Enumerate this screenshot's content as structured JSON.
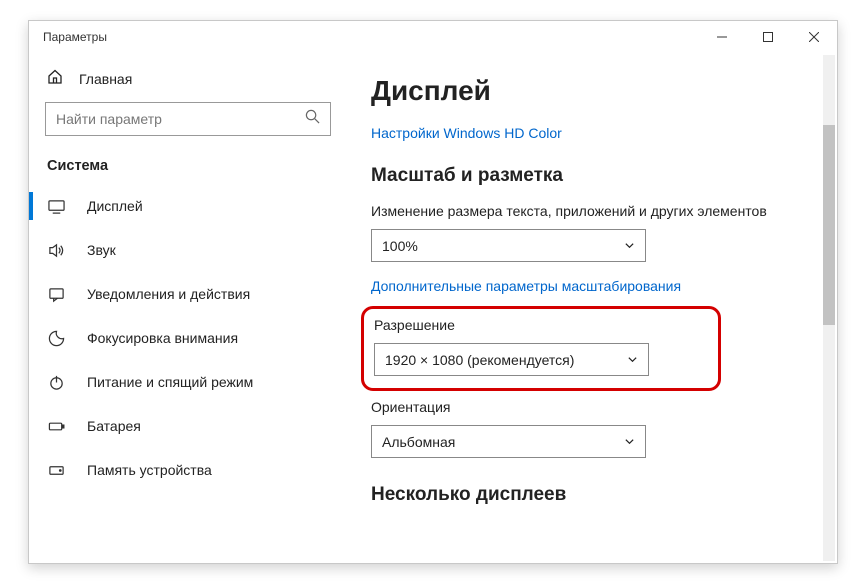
{
  "window": {
    "title": "Параметры"
  },
  "home": {
    "label": "Главная"
  },
  "search": {
    "placeholder": "Найти параметр"
  },
  "section": {
    "label": "Система"
  },
  "nav": {
    "items": [
      {
        "label": "Дисплей"
      },
      {
        "label": "Звук"
      },
      {
        "label": "Уведомления и действия"
      },
      {
        "label": "Фокусировка внимания"
      },
      {
        "label": "Питание и спящий режим"
      },
      {
        "label": "Батарея"
      },
      {
        "label": "Память устройства"
      }
    ]
  },
  "main": {
    "title": "Дисплей",
    "link1": "Настройки Windows HD Color",
    "h2a": "Масштаб и разметка",
    "scale_label": "Изменение размера текста, приложений и других элементов",
    "scale_value": "100%",
    "link2": "Дополнительные параметры масштабирования",
    "res_label": "Разрешение",
    "res_value": "1920 × 1080 (рекомендуется)",
    "orient_label": "Ориентация",
    "orient_value": "Альбомная",
    "h2b": "Несколько дисплеев"
  }
}
